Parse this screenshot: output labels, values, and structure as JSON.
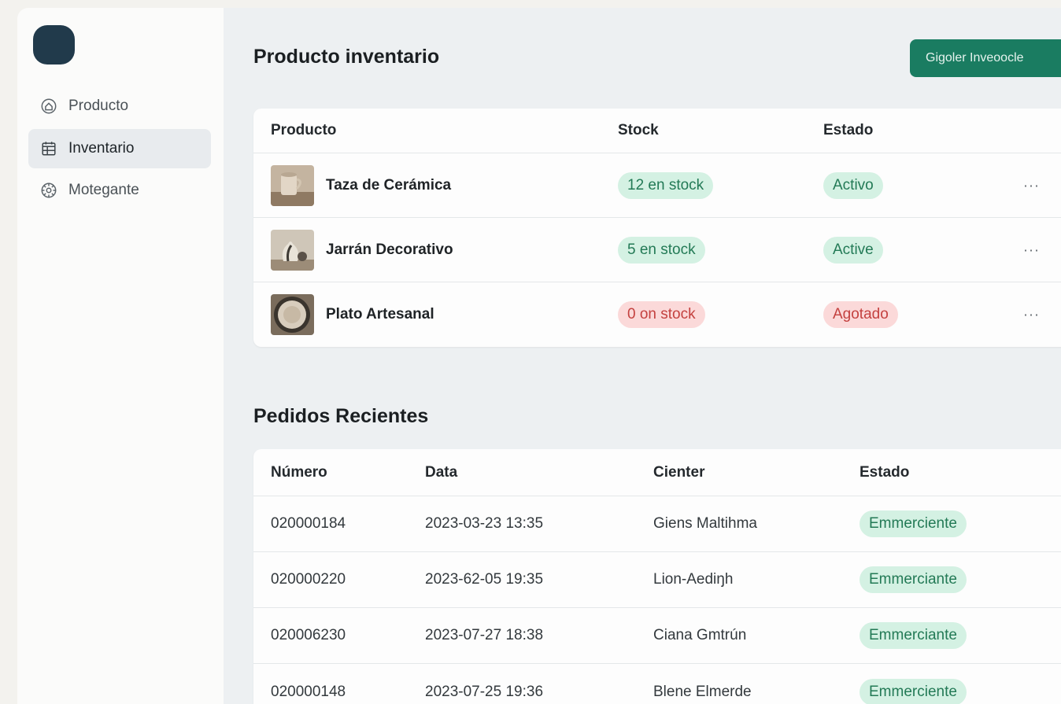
{
  "sidebar": {
    "items": [
      {
        "label": "Producto",
        "icon": "home-icon",
        "active": false
      },
      {
        "label": "Inventario",
        "icon": "calendar-icon",
        "active": true
      },
      {
        "label": "Motegante",
        "icon": "settings-icon",
        "active": false
      }
    ]
  },
  "header": {
    "title": "Producto inventario",
    "action_label": "Gigoler Inveoocle"
  },
  "inventory": {
    "columns": [
      "Producto",
      "Stock",
      "Estado"
    ],
    "rows": [
      {
        "name": "Taza de Cerámica",
        "stock": "12 en stock",
        "stock_status": "green",
        "status": "Activo",
        "status_color": "green",
        "actions": "···"
      },
      {
        "name": "Jarrán Decorativo",
        "stock": "5 en stock",
        "stock_status": "green",
        "status": "Active",
        "status_color": "green",
        "actions": "···"
      },
      {
        "name": "Plato Artesanal",
        "stock": "0 on stock",
        "stock_status": "red",
        "status": "Agotado",
        "status_color": "red",
        "actions": "···"
      }
    ]
  },
  "orders": {
    "title": "Pedidos Recientes",
    "columns": [
      "Número",
      "Data",
      "Cienter",
      "Estado"
    ],
    "rows": [
      {
        "number": "020000184",
        "date": "2023-03-23 13:35",
        "client": "Giens Maltihma",
        "status": "Emmerciente"
      },
      {
        "number": "020000220",
        "date": "2023-62-05 19:35",
        "client": "Lion-Aediŋh",
        "status": "Emmerciante"
      },
      {
        "number": "020006230",
        "date": "2023-07-27 18:38",
        "client": "Ciana Gmtrún",
        "status": "Emmerciante"
      },
      {
        "number": "020000148",
        "date": "2023-07-25 19:36",
        "client": "Blene Elmerde",
        "status": "Emmerciente"
      }
    ]
  },
  "colors": {
    "primary": "#1a7c61",
    "sidebar_bg": "#fbfbfa",
    "main_bg": "#edf0f2",
    "logo": "#213a4b",
    "success_bg": "#d4f1e3",
    "success_text": "#237a56",
    "danger_bg": "#fbd9d9",
    "danger_text": "#c4413f"
  }
}
